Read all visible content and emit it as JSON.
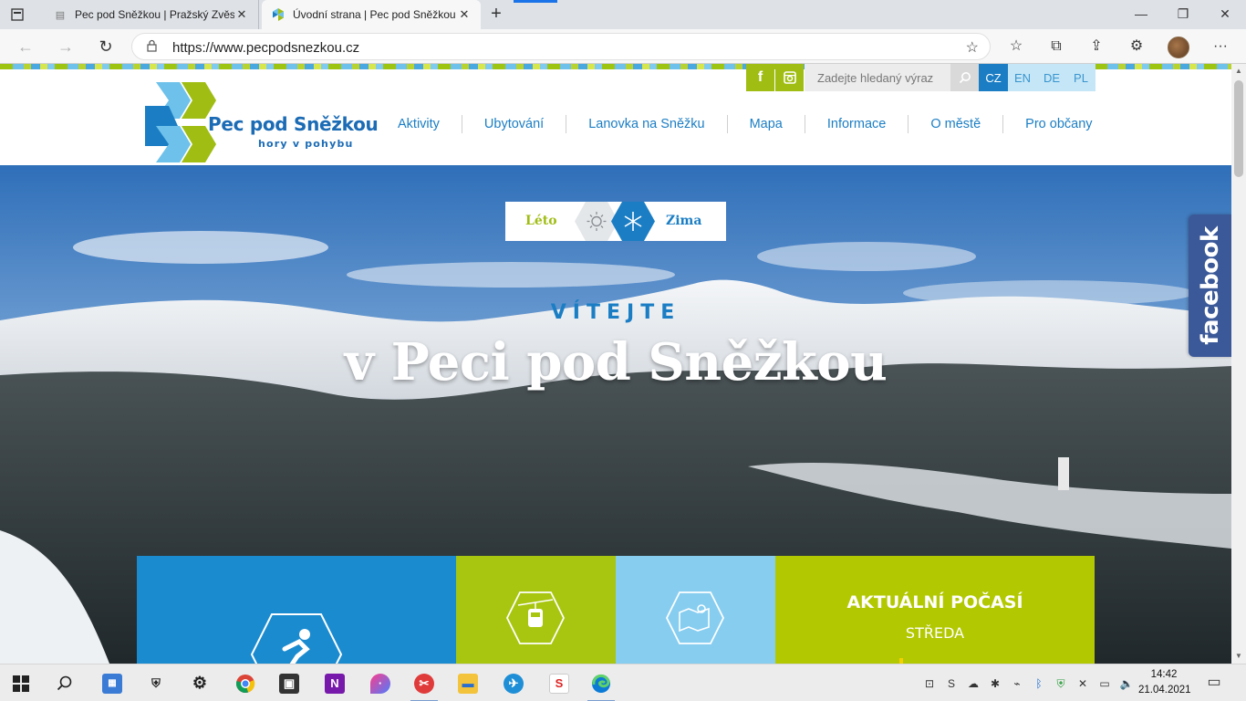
{
  "browser": {
    "tabs": [
      {
        "title": "Pec pod Sněžkou | Pražský Zvěst",
        "active": false
      },
      {
        "title": "Úvodní strana | Pec pod Sněžkou",
        "active": true
      }
    ],
    "new_tab_label": "+",
    "url": "https://www.pecpodsnezkou.cz",
    "window_controls": {
      "minimize": "—",
      "maximize": "❐",
      "close": "✕"
    }
  },
  "site": {
    "logo": {
      "name": "Pec pod Sněžkou",
      "tagline": "hory v pohybu"
    },
    "social": {
      "facebook": "f",
      "instagram": "◘"
    },
    "search": {
      "placeholder": "Zadejte hledaný výraz"
    },
    "languages": [
      {
        "code": "CZ",
        "active": true
      },
      {
        "code": "EN",
        "active": false
      },
      {
        "code": "DE",
        "active": false
      },
      {
        "code": "PL",
        "active": false
      }
    ],
    "nav": [
      "Aktivity",
      "Ubytování",
      "Lanovka na Sněžku",
      "Mapa",
      "Informace",
      "O městě",
      "Pro občany"
    ],
    "season": {
      "summer": "Léto",
      "winter": "Zima",
      "selected": "Zima"
    },
    "hero": {
      "welcome": "VÍTEJTE",
      "headline": "v Peci pod Sněžkou"
    },
    "facebook_side": "facebook",
    "tiles": {
      "weather_title": "AKTUÁLNÍ POČASÍ",
      "weather_day": "STŘEDA"
    },
    "colors": {
      "blue": "#1b7ec4",
      "green": "#9fbd13",
      "lightblue": "#7fcbef",
      "lime": "#b2c800"
    }
  },
  "taskbar": {
    "time": "14:42",
    "date": "21.04.2021"
  }
}
